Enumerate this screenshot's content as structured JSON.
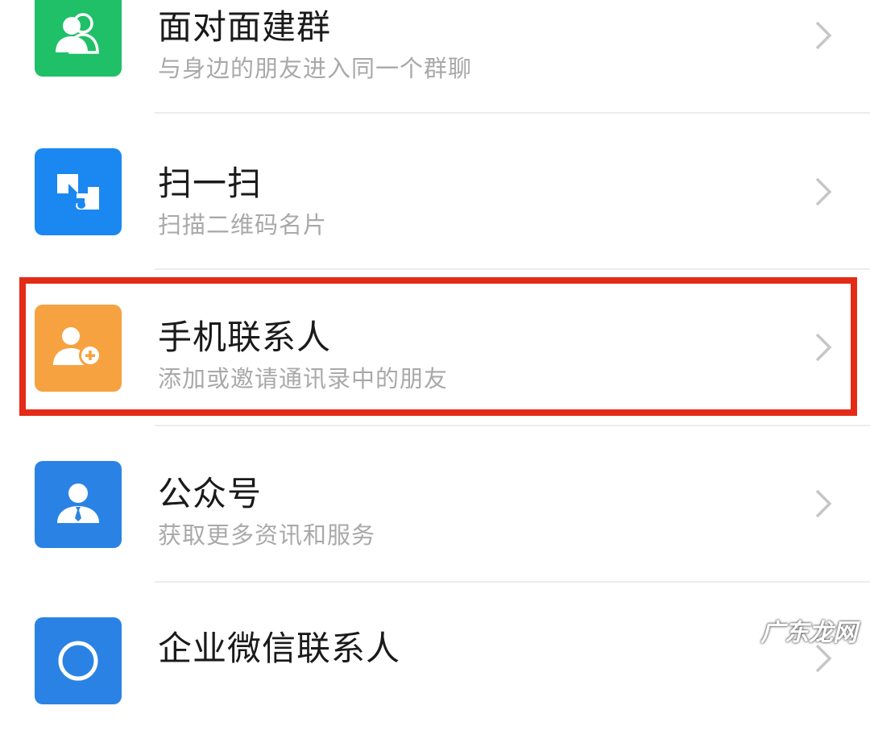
{
  "items": [
    {
      "title": "面对面建群",
      "subtitle": "与身边的朋友进入同一个群聊",
      "icon": "group-people-icon",
      "color": "#1fc067"
    },
    {
      "title": "扫一扫",
      "subtitle": "扫描二维码名片",
      "icon": "scan-icon",
      "color": "#1a88f0"
    },
    {
      "title": "手机联系人",
      "subtitle": "添加或邀请通讯录中的朋友",
      "icon": "add-contact-icon",
      "color": "#f7a240"
    },
    {
      "title": "公众号",
      "subtitle": "获取更多资讯和服务",
      "icon": "official-account-icon",
      "color": "#2a83e4"
    },
    {
      "title": "企业微信联系人",
      "subtitle": "",
      "icon": "enterprise-contact-icon",
      "color": "#2a83e4"
    }
  ],
  "watermark": "广东龙网",
  "highlight_color": "#e32b18"
}
